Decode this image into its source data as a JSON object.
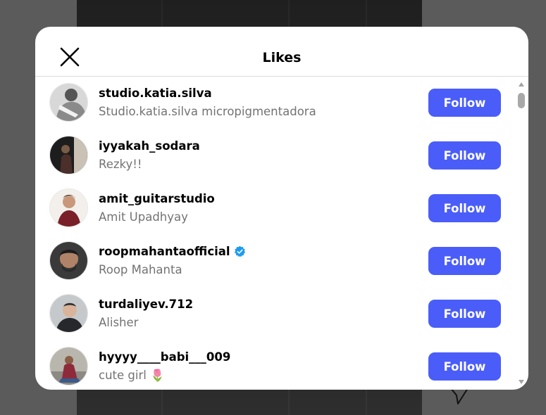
{
  "modal": {
    "title": "Likes",
    "close_icon": "close-icon"
  },
  "colors": {
    "follow_button": "#4a5df9",
    "verified_badge": "#1d9bf0",
    "secondary_text": "#737373"
  },
  "likes": [
    {
      "username": "studio.katia.silva",
      "full_name": "Studio.katia.silva micropigmentadora",
      "verified": false,
      "button": "Follow"
    },
    {
      "username": "iyyakah_sodara",
      "full_name": "Rezky!!",
      "verified": false,
      "button": "Follow"
    },
    {
      "username": "amit_guitarstudio",
      "full_name": "Amit Upadhyay",
      "verified": false,
      "button": "Follow"
    },
    {
      "username": "roopmahantaofficial",
      "full_name": "Roop Mahanta",
      "verified": true,
      "button": "Follow"
    },
    {
      "username": "turdaliyev.712",
      "full_name": "Alisher",
      "verified": false,
      "button": "Follow"
    },
    {
      "username": "hyyyy____babi___009",
      "full_name": "cute girl 🌷",
      "verified": false,
      "button": "Follow"
    }
  ]
}
